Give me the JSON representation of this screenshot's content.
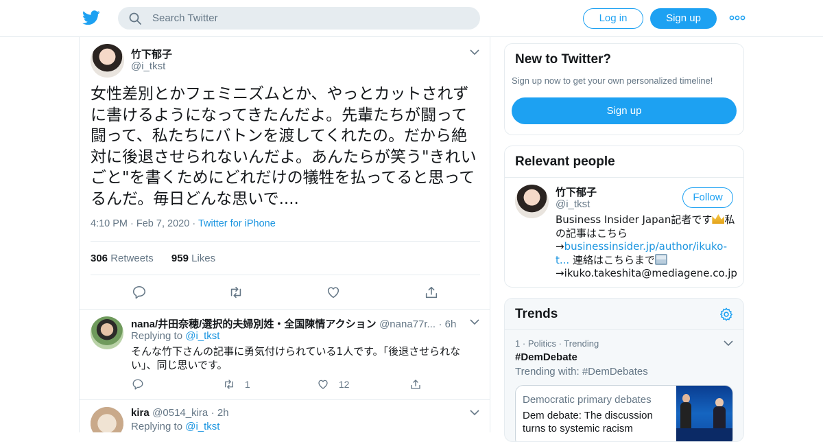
{
  "header": {
    "search_placeholder": "Search Twitter",
    "login_label": "Log in",
    "signup_label": "Sign up"
  },
  "tweet": {
    "name": "竹下郁子",
    "handle": "@i_tkst",
    "text": "女性差別とかフェミニズムとか、やっとカットされずに書けるようになってきたんだよ。先輩たちが闘って闘って、私たちにバトンを渡してくれたの。だから絶対に後退させられないんだよ。あんたらが笑う\"きれいごと\"を書くためにどれだけの犠牲を払ってると思ってるんだ。毎日どんな思いで....",
    "time": "4:10 PM",
    "date": "Feb 7, 2020",
    "source": "Twitter for iPhone",
    "retweets_count": "306",
    "retweets_label": "Retweets",
    "likes_count": "959",
    "likes_label": "Likes"
  },
  "replies": [
    {
      "name": "nana/井田奈穂/選択的夫婦別姓・全国陳情アクション",
      "handle": "@nana77r...",
      "age": "6h",
      "replying_prefix": "Replying to",
      "replying_to": "@i_tkst",
      "text": "そんな竹下さんの記事に勇気付けられている1人です。「後退させられない」、同じ思いです。",
      "retweets": "1",
      "likes": "12"
    },
    {
      "name": "kira",
      "handle": "@0514_kira",
      "age": "2h",
      "replying_prefix": "Replying to",
      "replying_to": "@i_tkst"
    }
  ],
  "sidebar": {
    "new_title": "New to Twitter?",
    "new_sub": "Sign up now to get your own personalized timeline!",
    "new_button": "Sign up",
    "people_title": "Relevant people",
    "person": {
      "name": "竹下郁子",
      "handle": "@i_tkst",
      "follow_label": "Follow",
      "bio_1": "Business Insider Japan記者です",
      "bio_2": "私の記事はこちら→",
      "bio_link": "businessinsider.jp/author/ikuko-t...",
      "bio_3": " 連絡はこちらまで",
      "bio_4": "→ikuko.takeshita@mediagene.co.jp"
    },
    "trends_title": "Trends",
    "trend": {
      "rank": "1",
      "category": "Politics",
      "status": "Trending",
      "tag": "#DemDebate",
      "with": "Trending with: #DemDebates",
      "news_topic": "Democratic primary debates",
      "news_headline": "Dem debate: The discussion turns to systemic racism"
    }
  },
  "colors": {
    "accent": "#1da1f2",
    "link": "#1b95e0",
    "muted": "#657786",
    "border": "#e6ecf0"
  },
  "icons": [
    "twitter-bird-icon",
    "search-icon",
    "more-dots-icon",
    "chevron-down-icon",
    "reply-icon",
    "retweet-icon",
    "like-icon",
    "share-icon",
    "gear-icon",
    "crown-emoji",
    "inbox-emoji"
  ]
}
